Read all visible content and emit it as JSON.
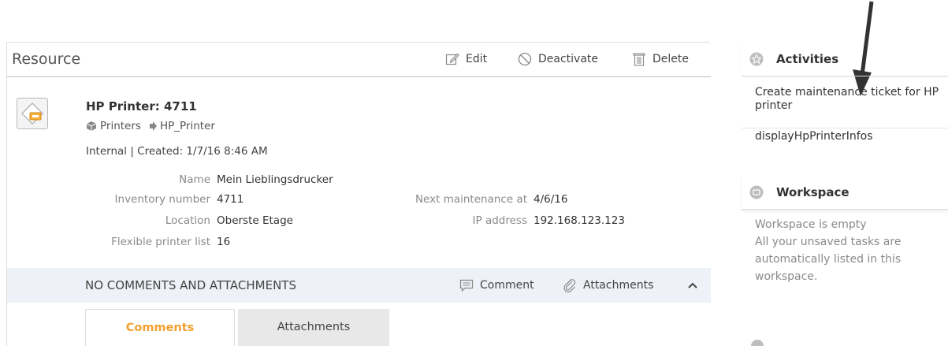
{
  "resource": {
    "panel_title": "Resource",
    "actions": {
      "edit": "Edit",
      "deactivate": "Deactivate",
      "delete": "Delete"
    },
    "title": "HP Printer: 4711",
    "breadcrumb": {
      "category": "Printers",
      "type": "HP_Printer"
    },
    "meta": "Internal | Created: 1/7/16 8:46 AM",
    "fields": {
      "name_label": "Name",
      "name_value": "Mein Lieblingsdrucker",
      "inventory_label": "Inventory number",
      "inventory_value": "4711",
      "location_label": "Location",
      "location_value": "Oberste Etage",
      "flexible_label": "Flexible printer list",
      "flexible_value": "16",
      "maintenance_label": "Next maintenance at",
      "maintenance_value": "4/6/16",
      "ip_label": "IP address",
      "ip_value": "192.168.123.123"
    },
    "comments_bar": {
      "title": "NO COMMENTS AND ATTACHMENTS",
      "comment": "Comment",
      "attachments": "Attachments"
    },
    "tabs": {
      "comments": "Comments",
      "attachments": "Attachments"
    }
  },
  "sidebar": {
    "activities_title": "Activities",
    "activities": [
      {
        "label": "Create maintenance ticket for HP printer"
      },
      {
        "label": "displayHpPrinterInfos"
      }
    ],
    "workspace_title": "Workspace",
    "workspace_empty": "Workspace is empty",
    "workspace_hint": "All your unsaved tasks are automatically listed in this workspace."
  },
  "colors": {
    "accent": "#f0a030",
    "bar_bg": "#eef1f7",
    "tab_inactive": "#e8e8e8"
  }
}
